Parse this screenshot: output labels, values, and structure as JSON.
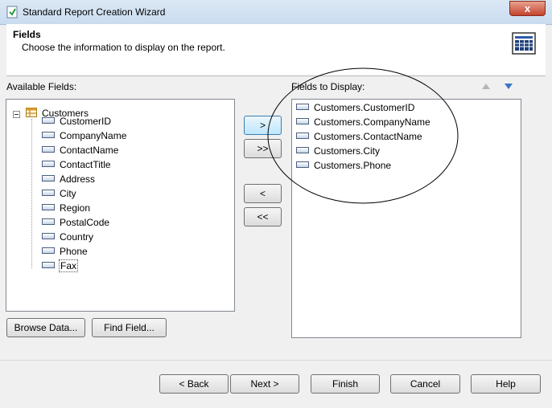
{
  "window": {
    "title": "Standard Report Creation Wizard",
    "close_symbol": "x"
  },
  "header": {
    "title": "Fields",
    "subtitle": "Choose the information to display on the report."
  },
  "available": {
    "label": "Available Fields:",
    "table": "Customers",
    "fields": [
      "CustomerID",
      "CompanyName",
      "ContactName",
      "ContactTitle",
      "Address",
      "City",
      "Region",
      "PostalCode",
      "Country",
      "Phone",
      "Fax"
    ]
  },
  "display": {
    "label": "Fields to Display:",
    "fields": [
      "Customers.CustomerID",
      "Customers.CompanyName",
      "Customers.ContactName",
      "Customers.City",
      "Customers.Phone"
    ]
  },
  "transfer": {
    "add": ">",
    "add_all": ">>",
    "remove": "<",
    "remove_all": "<<"
  },
  "actions": {
    "browse": "Browse Data...",
    "find": "Find Field..."
  },
  "footer": {
    "back": "< Back",
    "next": "Next >",
    "finish": "Finish",
    "cancel": "Cancel",
    "help": "Help"
  },
  "icons": [
    "app-icon",
    "report-icon",
    "table-icon",
    "field-icon",
    "move-up-icon",
    "move-down-icon",
    "close-icon"
  ]
}
